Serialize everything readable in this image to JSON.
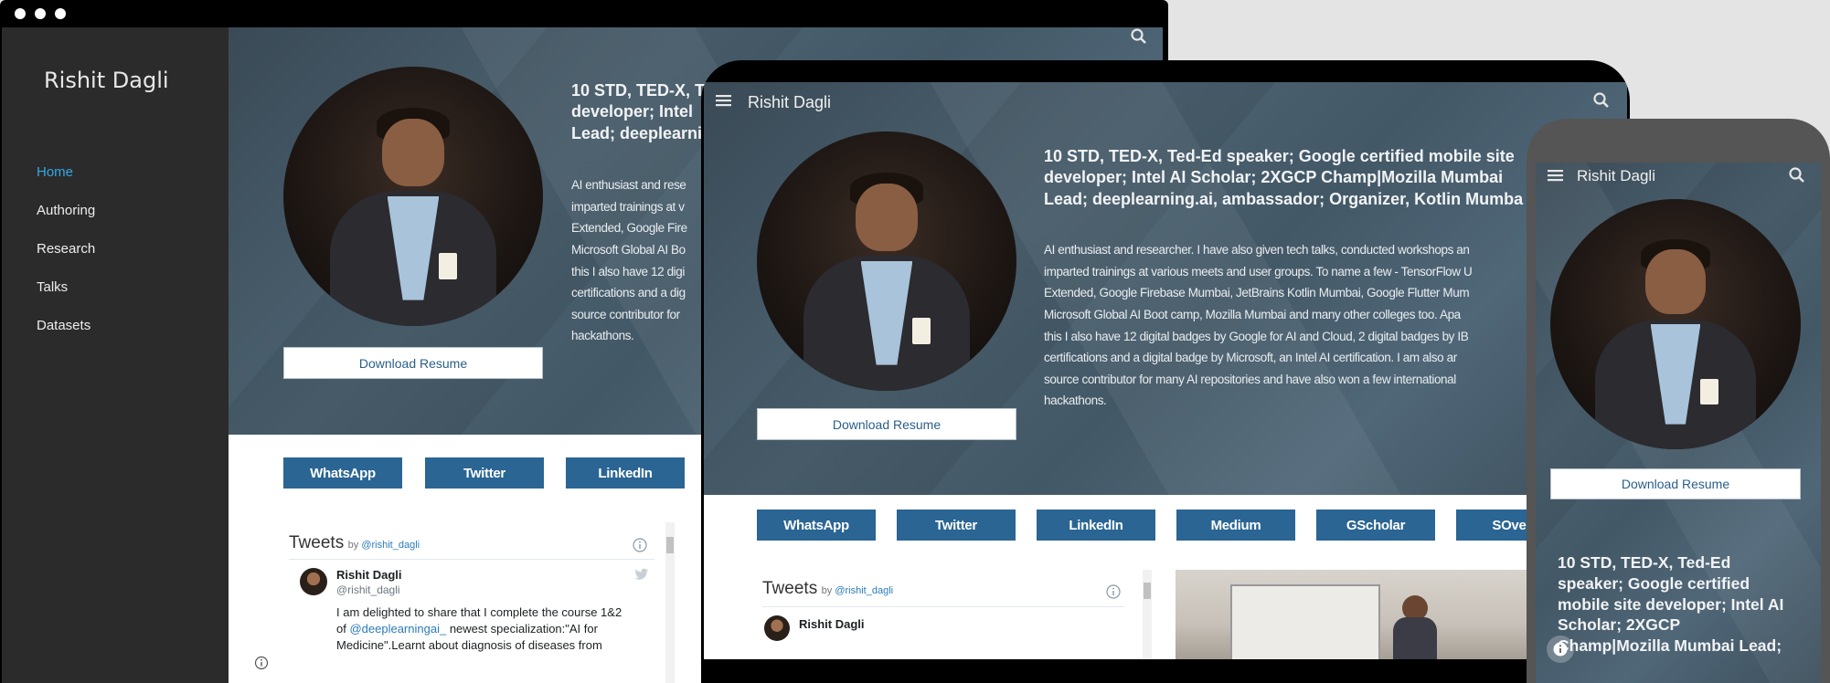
{
  "desktop": {
    "site_title": "Rishit Dagli",
    "nav": [
      {
        "label": "Home",
        "active": true
      },
      {
        "label": "Authoring",
        "active": false
      },
      {
        "label": "Research",
        "active": false
      },
      {
        "label": "Talks",
        "active": false
      },
      {
        "label": "Datasets",
        "active": false
      }
    ],
    "heading_lines": [
      "10 STD, TED-X, T",
      "developer; Intel",
      "Lead; deeplearni"
    ],
    "bio_lines": [
      "AI enthusiast and rese",
      "imparted trainings at v",
      "Extended, Google Fire",
      "Microsoft Global AI Bo",
      "this I also have 12 digi",
      "certifications and a dig",
      "source contributor for",
      "hackathons."
    ],
    "resume_label": "Download Resume",
    "social": [
      "WhatsApp",
      "Twitter",
      "LinkedIn"
    ],
    "tweets": {
      "title": "Tweets",
      "by": "by",
      "handle": "@rishit_dagli",
      "author_name": "Rishit Dagli",
      "author_handle": "@rishit_dagli",
      "text_1": "I am delighted to share that I complete the course 1&2",
      "text_2a": "of ",
      "text_2_mention": "@deeplearningai_",
      "text_2b": " newest specialization:\"AI for",
      "text_3": "Medicine\".Learnt about diagnosis of diseases from"
    }
  },
  "tablet": {
    "site_title": "Rishit Dagli",
    "heading_lines": [
      "10 STD, TED-X, Ted-Ed speaker; Google certified mobile site",
      "developer; Intel AI Scholar; 2XGCP Champ|Mozilla Mumbai",
      "Lead; deeplearning.ai, ambassador; Organizer, Kotlin Mumba"
    ],
    "bio_lines": [
      "AI enthusiast and researcher. I have also given tech talks, conducted workshops an",
      "imparted trainings at various meets and user groups. To name a few - TensorFlow U",
      "Extended, Google Firebase Mumbai, JetBrains Kotlin Mumbai, Google Flutter Mum",
      "Microsoft Global AI Boot camp, Mozilla Mumbai and many other colleges too. Apa",
      "this I also have 12 digital badges by Google for AI and Cloud, 2 digital badges by IB",
      "certifications and a digital badge by Microsoft, an Intel AI certification. I am also ar",
      "source contributor for many AI repositories and have also won a few international",
      "hackathons."
    ],
    "resume_label": "Download Resume",
    "social": [
      "WhatsApp",
      "Twitter",
      "LinkedIn",
      "Medium",
      "GScholar",
      "SOverfl"
    ],
    "tweets": {
      "title": "Tweets",
      "by": "by",
      "handle": "@rishit_dagli",
      "author_name": "Rishit Dagli"
    }
  },
  "mobile": {
    "site_title": "Rishit Dagli",
    "resume_label": "Download Resume",
    "heading_lines": [
      "10 STD, TED-X, Ted-Ed",
      "speaker; Google certified",
      "mobile site developer; Intel AI",
      "Scholar; 2XGCP",
      "Champ|Mozilla Mumbai Lead;"
    ]
  }
}
